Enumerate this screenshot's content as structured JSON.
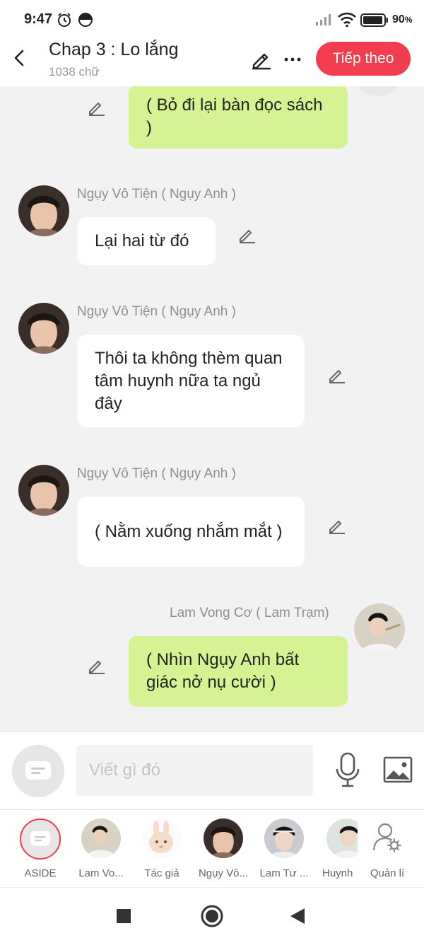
{
  "status": {
    "time": "9:47",
    "battery": "90"
  },
  "header": {
    "title": "Chap 3 : Lo lắng",
    "word_count": "1038 chữ",
    "next_label": "Tiếp theo"
  },
  "messages": [
    {
      "text": "( Bỏ đi lại bàn đọc sách )"
    },
    {
      "name": "Ngụy Vô Tiện ( Ngụy Anh )",
      "text": "Lại hai từ đó"
    },
    {
      "name": "Ngụy Vô Tiện ( Ngụy Anh )",
      "text": "Thôi ta không thèm quan tâm huynh nữa ta ngủ đây"
    },
    {
      "name": "Ngụy Vô Tiện ( Ngụy Anh )",
      "text": "( Nằm xuống nhắm mắt )"
    },
    {
      "name": "Lam Vong Cơ ( Lam Trạm)",
      "text": "( Nhìn Ngụy Anh bất giác nở nụ cười )"
    }
  ],
  "input": {
    "placeholder": "Viết gì đó"
  },
  "characters": [
    {
      "label": "ASIDE"
    },
    {
      "label": "Lam Vo..."
    },
    {
      "label": "Tác giả"
    },
    {
      "label": "Ngụy Vô..."
    },
    {
      "label": "Lam Tư ..."
    },
    {
      "label": "Huynh"
    },
    {
      "label": "Quản lí"
    }
  ],
  "colors": {
    "accent": "#f23d4f",
    "bubble_green": "#d6f394",
    "bubble_white": "#ffffff",
    "background": "#f2f2f2"
  }
}
